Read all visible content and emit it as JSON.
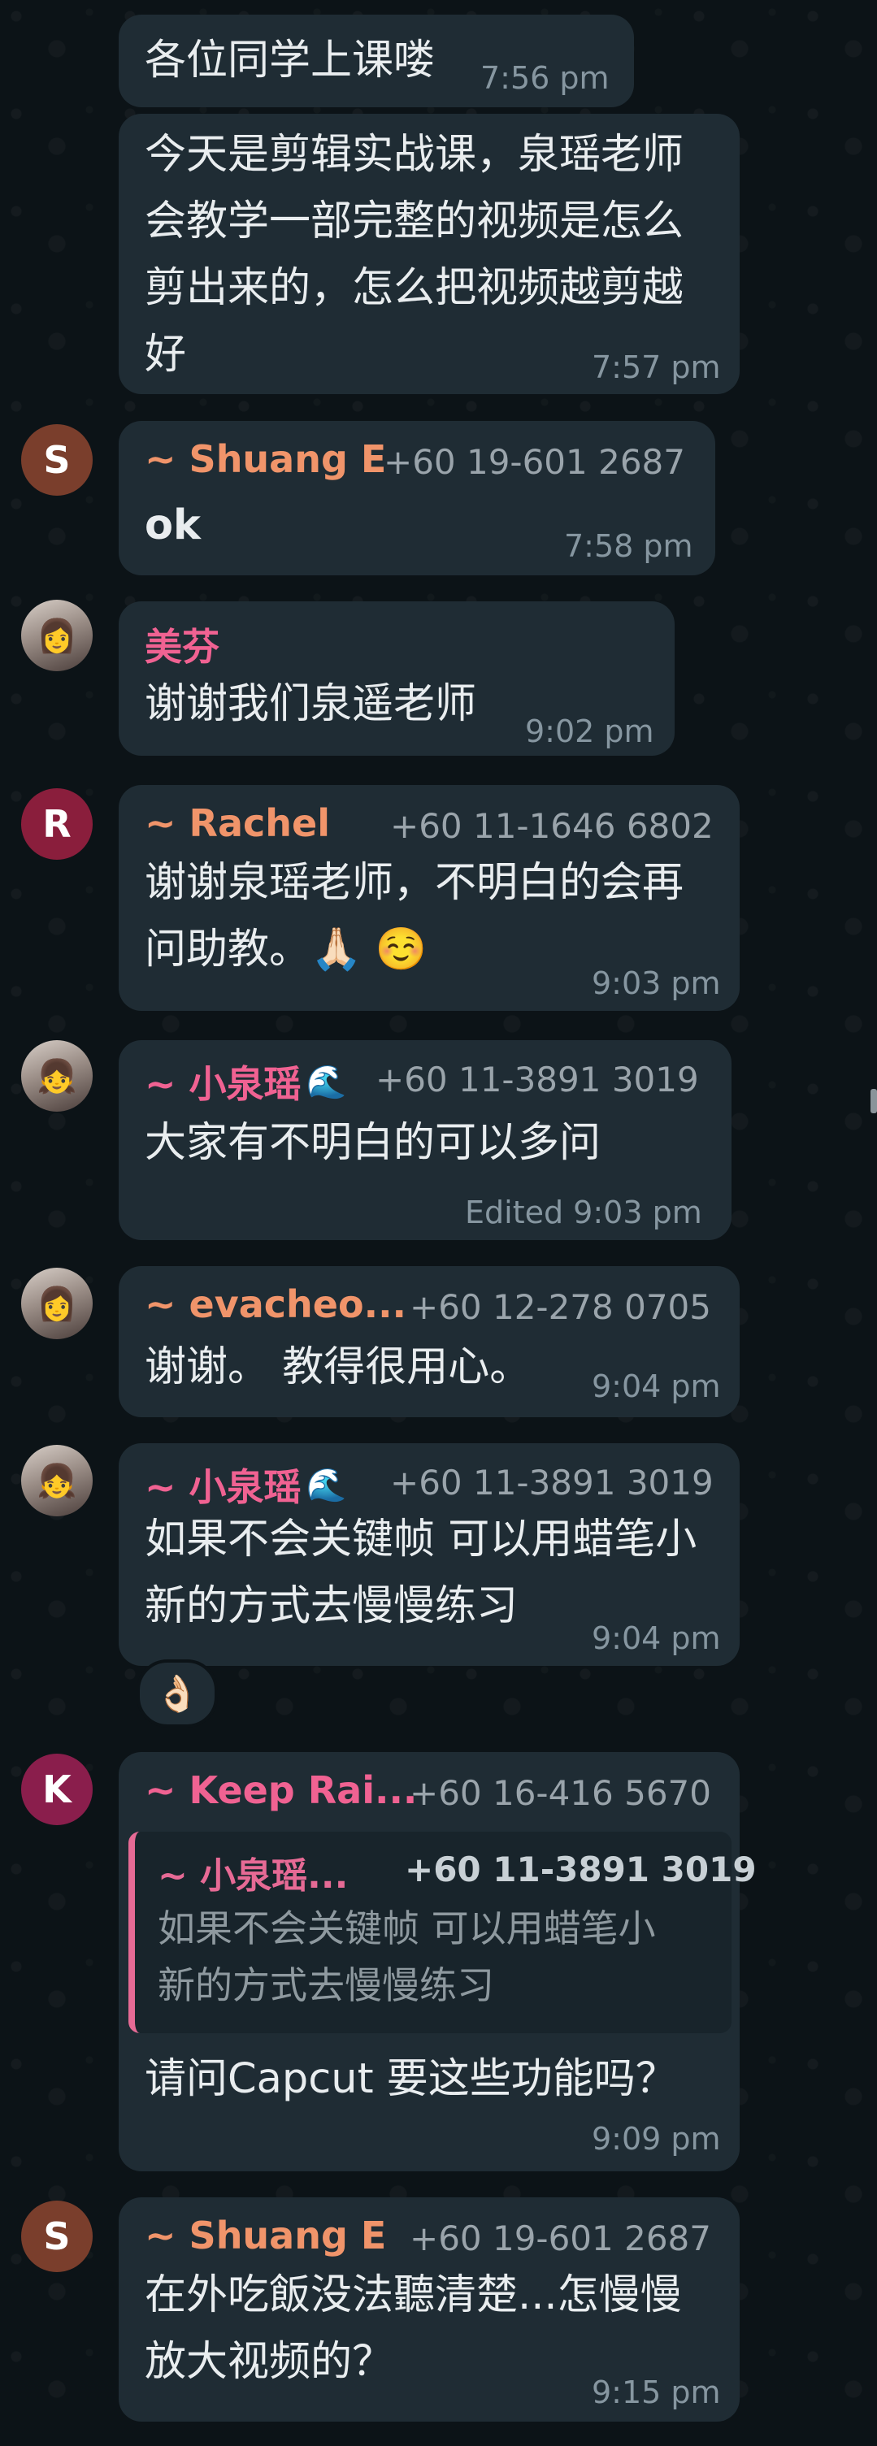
{
  "colors": {
    "background": "#0b141a",
    "bubble": "#1f2c34",
    "timestamp": "#8696a0",
    "text": "#e9edef"
  },
  "messages": [
    {
      "text_lines": [
        "各位同学上课喽"
      ],
      "time": "7:56 pm"
    },
    {
      "text_lines": [
        "今天是剪辑实战课，泉瑶老师",
        "会教学一部完整的视频是怎么",
        "剪出来的，怎么把视频越剪越",
        "好"
      ],
      "time": "7:57 pm"
    },
    {
      "avatar_letter": "S",
      "sender": "~ Shuang E",
      "phone": "+60 19-601 2687",
      "text_lines": [
        "ok"
      ],
      "time": "7:58 pm"
    },
    {
      "avatar_icon": "user-photo-icon",
      "sender": "美芬",
      "text_lines": [
        "谢谢我们泉遥老师"
      ],
      "time": "9:02 pm"
    },
    {
      "avatar_letter": "R",
      "sender": "~ Rachel",
      "phone": "+60 11-1646 6802",
      "text_lines": [
        "谢谢泉瑶老师，不明白的会再",
        "问助教。🙏🏻 ☺️"
      ],
      "time": "9:03 pm"
    },
    {
      "avatar_icon": "user-photo-icon",
      "sender": "~ 小泉瑶",
      "sender_emoji": "🌊",
      "phone": "+60 11-3891 3019",
      "text_lines": [
        "大家有不明白的可以多问"
      ],
      "time": "Edited 9:03 pm"
    },
    {
      "avatar_icon": "user-photo-icon",
      "sender": "~ evacheo...",
      "phone": "+60 12-278 0705",
      "text_lines": [
        "谢谢。 教得很用心。"
      ],
      "time": "9:04 pm"
    },
    {
      "avatar_icon": "user-photo-icon",
      "sender": "~ 小泉瑶",
      "sender_emoji": "🌊",
      "phone": "+60 11-3891 3019",
      "text_lines": [
        "如果不会关键帧 可以用蜡笔小",
        "新的方式去慢慢练习"
      ],
      "time": "9:04 pm",
      "reaction": "👌🏻"
    },
    {
      "avatar_letter": "K",
      "sender": "~ Keep Rai...",
      "phone": "+60 16-416 5670",
      "quote": {
        "sender": "~ 小泉瑶...",
        "phone": "+60 11-3891 3019",
        "text_lines": [
          "如果不会关键帧 可以用蜡笔小",
          "新的方式去慢慢练习"
        ]
      },
      "text_lines": [
        "请问Capcut 要这些功能吗？"
      ],
      "time": "9:09 pm"
    },
    {
      "avatar_letter": "S",
      "sender": "~ Shuang E",
      "phone": "+60 19-601 2687",
      "text_lines": [
        "在外吃飯没法聽清楚...怎慢慢",
        "放大视频的？"
      ],
      "time": "9:15 pm"
    }
  ]
}
